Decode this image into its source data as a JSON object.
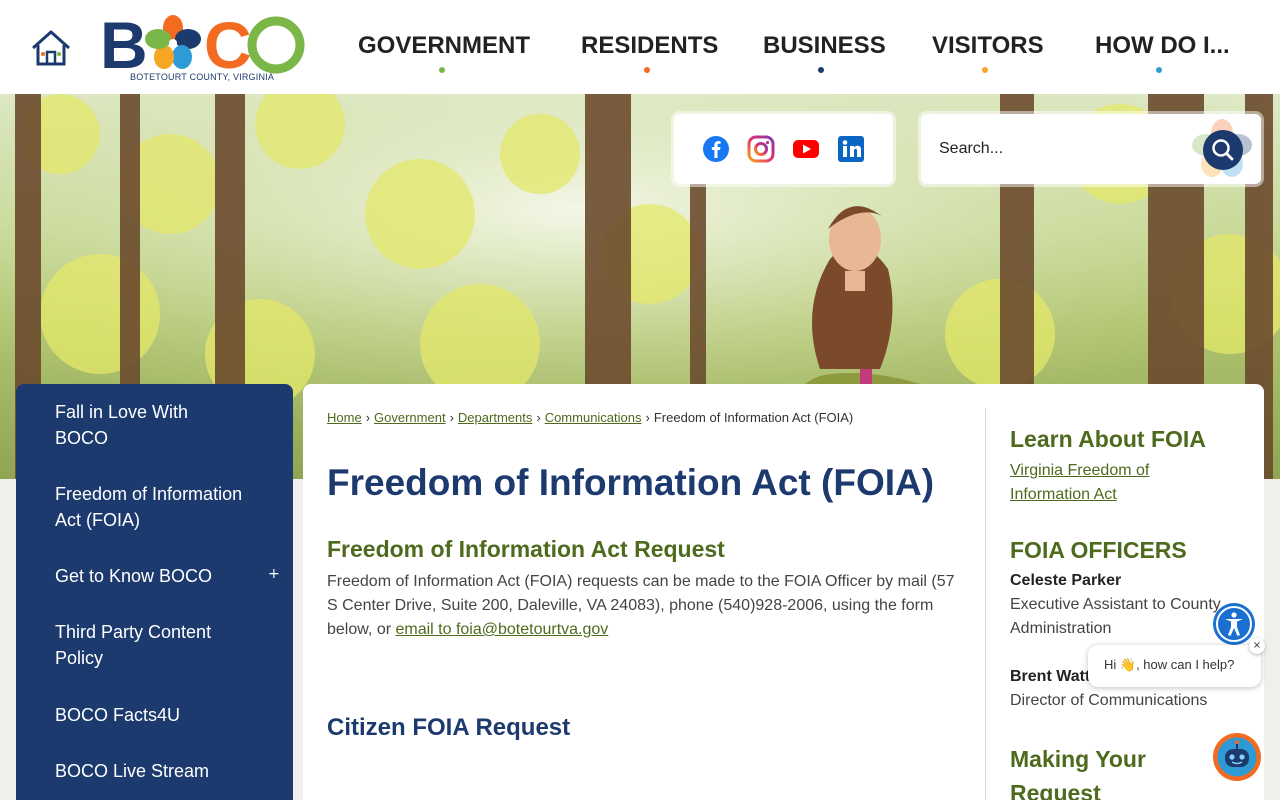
{
  "header": {
    "logo_subtitle": "BOTETOURT COUNTY, VIRGINIA",
    "nav": [
      {
        "label": "GOVERNMENT",
        "dot_color": "#7ab648"
      },
      {
        "label": "RESIDENTS",
        "dot_color": "#f36a21"
      },
      {
        "label": "BUSINESS",
        "dot_color": "#1c3a6e"
      },
      {
        "label": "VISITORS",
        "dot_color": "#f6a623"
      },
      {
        "label": "HOW DO I...",
        "dot_color": "#2e9bd6"
      }
    ]
  },
  "search": {
    "placeholder": "Search..."
  },
  "social": [
    "facebook-icon",
    "instagram-icon",
    "youtube-icon",
    "linkedin-icon"
  ],
  "sidebar": {
    "items": [
      {
        "label": "Fall in Love With BOCO"
      },
      {
        "label": "Freedom of Information Act (FOIA)"
      },
      {
        "label": "Get to Know BOCO",
        "expandable": "+"
      },
      {
        "label": "Third Party Content Policy"
      },
      {
        "label": "BOCO Facts4U"
      },
      {
        "label": "BOCO Live Stream"
      }
    ]
  },
  "breadcrumb": {
    "links": [
      "Home",
      "Government",
      "Departments",
      "Communications"
    ],
    "current": "Freedom of Information Act (FOIA)"
  },
  "main": {
    "title": "Freedom of Information Act (FOIA)",
    "section_heading": "Freedom of Information Act Request",
    "body": "Freedom of Information Act (FOIA) requests can be made to the FOIA Officer by mail (57 S Center Drive, Suite 200, Daleville, VA 24083), phone (540)928-2006, using the form below, or ",
    "email_link": "email to foia@botetourtva.gov",
    "section_heading_2": "Citizen FOIA Request"
  },
  "rail": {
    "learn_heading": "Learn About FOIA",
    "learn_link": "Virginia Freedom of Information Act",
    "officers_heading": "FOIA OFFICERS",
    "officers": [
      {
        "name": "Celeste Parker",
        "role": "Executive Assistant to County Administration"
      },
      {
        "name": "Brent Watts",
        "role": "Director of Communications"
      }
    ],
    "making_heading": "Making Your Request"
  },
  "chat": {
    "greeting": "Hi 👋, how can I help?",
    "close": "×"
  },
  "colors": {
    "navy": "#1c3a6e",
    "green": "#4e6a1c",
    "orange": "#f36a21"
  }
}
